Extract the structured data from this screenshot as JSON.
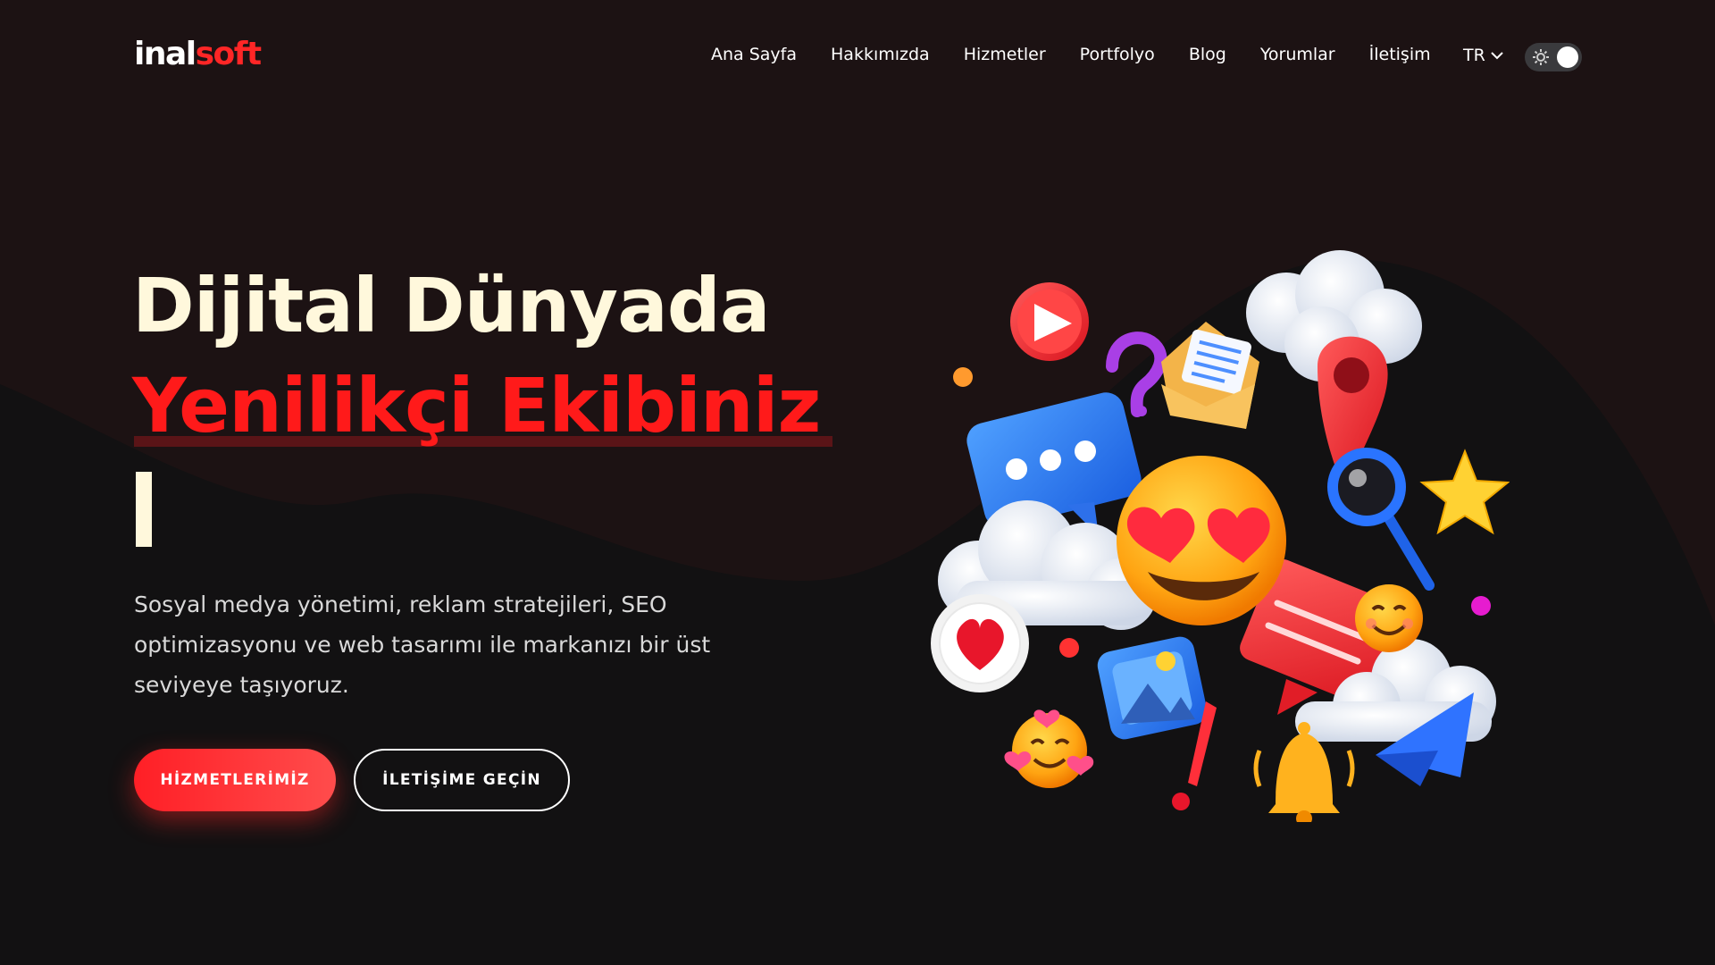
{
  "brand": {
    "logo_part1": "inal",
    "logo_part2": "soft",
    "accent": "#ff2626"
  },
  "nav": {
    "items": [
      "Ana Sayfa",
      "Hakkımızda",
      "Hizmetler",
      "Portfolyo",
      "Blog",
      "Yorumlar",
      "İletişim"
    ]
  },
  "language": {
    "current": "TR"
  },
  "theme_toggle": {
    "icon": "sun-icon",
    "state": "light"
  },
  "hero": {
    "title_line1": "Dijital Dünyada",
    "title_line2": "Yenilikçi Ekibiniz",
    "description": "Sosyal medya yönetimi, reklam stratejileri, SEO optimizasyonu ve web tasarımı ile markanızı bir üst seviyeye taşıyoruz.",
    "primary_button": "HİZMETLERİMİZ",
    "secondary_button": "İLETİŞİME GEÇİN"
  },
  "illustration": {
    "icons": [
      "play-icon",
      "question-icon",
      "envelope-icon",
      "cloud-icon",
      "location-pin-icon",
      "chat-bubble-icon",
      "heart-eyes-emoji-icon",
      "magnifier-icon",
      "star-icon",
      "heart-icon",
      "image-icon",
      "smiling-emoji-icon",
      "hugging-emoji-icon",
      "exclamation-icon",
      "bell-icon",
      "paper-plane-icon",
      "comment-card-icon"
    ]
  }
}
